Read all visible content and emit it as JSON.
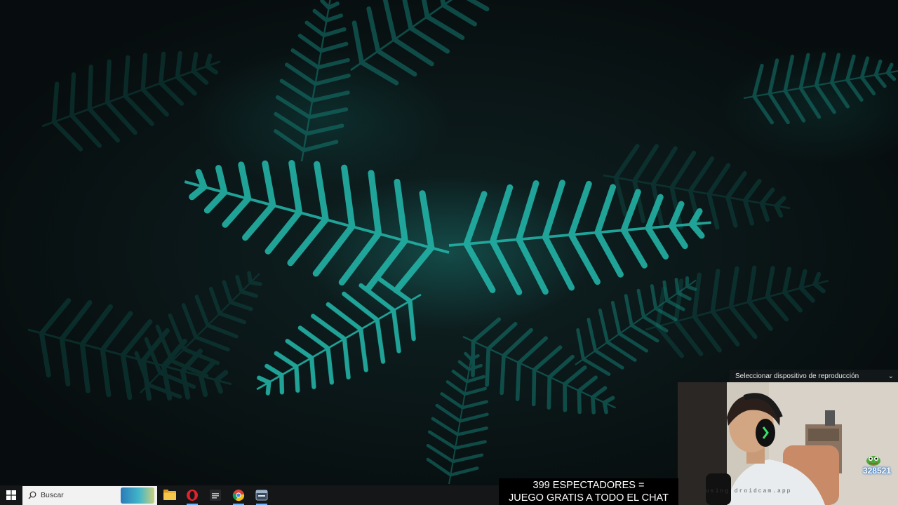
{
  "audio_device": {
    "label": "Seleccionar dispositivo de reproducción"
  },
  "webcam": {
    "watermark": "using droidcam.app",
    "counter": "328521"
  },
  "banner": {
    "line1": "399 ESPECTADORES =",
    "line2": "JUEGO GRATIS A TODO EL CHAT"
  },
  "taskbar": {
    "search_placeholder": "Buscar",
    "apps": [
      {
        "icon": "file-explorer-icon"
      },
      {
        "icon": "opera-icon"
      },
      {
        "icon": "game-launcher-icon"
      },
      {
        "icon": "chrome-icon"
      },
      {
        "icon": "app-window-icon"
      }
    ]
  },
  "colors": {
    "fern": "#1a9a90",
    "fern_bright": "#2fc7b9",
    "taskbar": "#141618",
    "banner_bg": "#000000"
  }
}
